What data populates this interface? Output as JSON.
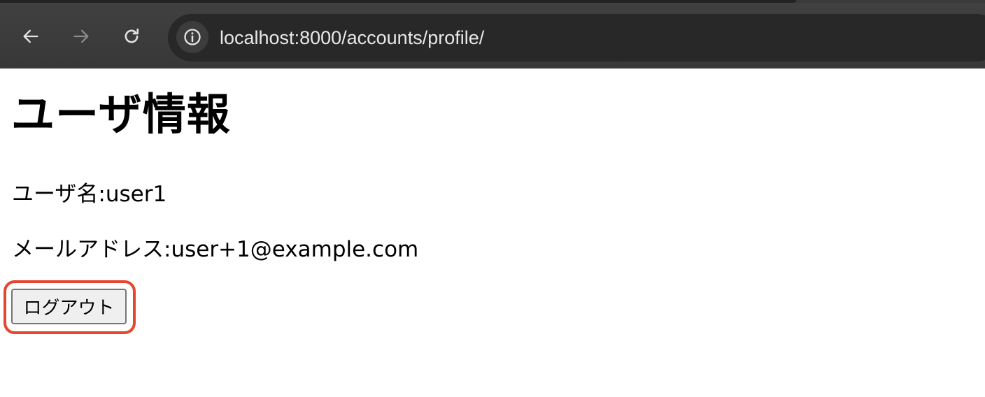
{
  "browser": {
    "url": "localhost:8000/accounts/profile/",
    "icons": {
      "back": "arrow-left-icon",
      "forward": "arrow-right-icon",
      "reload": "reload-icon",
      "site_info": "info-icon"
    },
    "colors": {
      "toolbar": "#404040",
      "omnibox": "#282828",
      "url_text": "#e8e8e8"
    }
  },
  "page": {
    "title": "ユーザ情報",
    "username_line": "ユーザ名:user1",
    "email_line": "メールアドレス:user+1@example.com",
    "logout_label": "ログアウト",
    "highlight_color": "#e4472b"
  }
}
